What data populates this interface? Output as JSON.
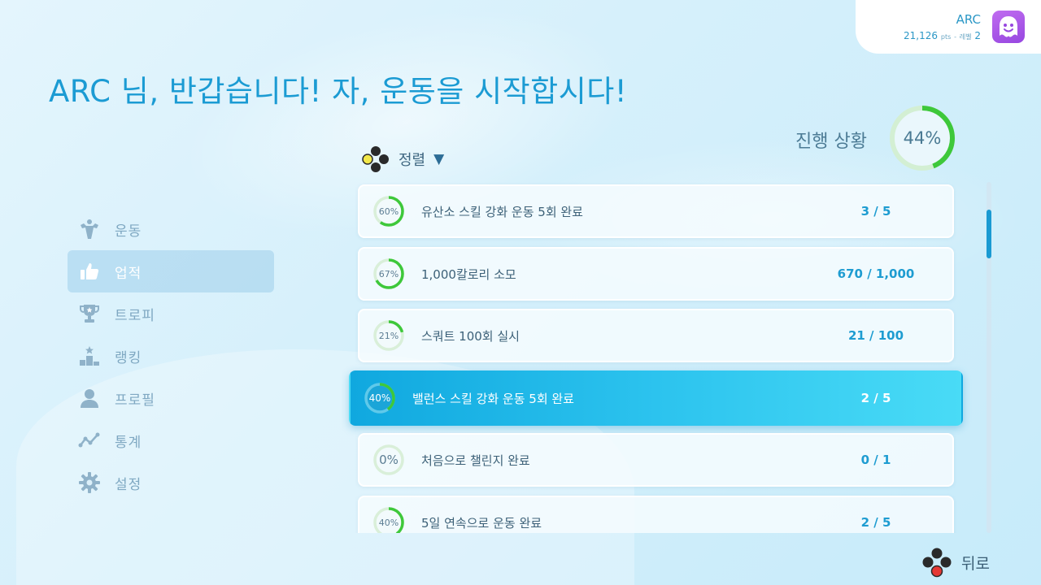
{
  "profile": {
    "name": "ARC",
    "points": "21,126",
    "points_unit": "pts",
    "separator": "-",
    "level_label": "레벨",
    "level": "2"
  },
  "greeting": "ARC 님, 반갑습니다! 자, 운동을 시작합시다!",
  "progress": {
    "label": "진행 상황",
    "percent_text": "44%",
    "value": 0.44
  },
  "sort": {
    "label": "정렬"
  },
  "sidebar": {
    "items": [
      {
        "label": "운동",
        "icon": "muscle-icon"
      },
      {
        "label": "업적",
        "icon": "thumbs-up-icon",
        "active": true
      },
      {
        "label": "트로피",
        "icon": "trophy-icon"
      },
      {
        "label": "랭킹",
        "icon": "podium-icon"
      },
      {
        "label": "프로필",
        "icon": "person-icon"
      },
      {
        "label": "통계",
        "icon": "line-graph-icon"
      },
      {
        "label": "설정",
        "icon": "gear-icon"
      }
    ]
  },
  "achievements": [
    {
      "percent_text": "60%",
      "value": 0.6,
      "title": "유산소 스킬 강화 운동 5회 완료",
      "count": "3 / 5"
    },
    {
      "percent_text": "67%",
      "value": 0.67,
      "title": "1,000칼로리 소모",
      "count": "670 / 1,000"
    },
    {
      "percent_text": "21%",
      "value": 0.21,
      "title": "스쿼트 100회 실시",
      "count": "21 / 100"
    },
    {
      "percent_text": "40%",
      "value": 0.4,
      "title": "밸런스 스킬 강화 운동 5회 완료",
      "count": "2 / 5",
      "selected": true
    },
    {
      "percent_text": "0%",
      "value": 0.0,
      "title": "처음으로 챌린지 완료",
      "count": "0 / 1"
    },
    {
      "percent_text": "40%",
      "value": 0.4,
      "title": "5일 연속으로 운동 완료",
      "count": "2 / 5"
    }
  ],
  "colors": {
    "accent": "#1b9bd3",
    "progress_green": "#3ec83a",
    "selected_gradient_start": "#10a8df",
    "selected_gradient_end": "#49dbf6",
    "avatar": "#a855e8"
  },
  "back": {
    "label": "뒤로"
  }
}
